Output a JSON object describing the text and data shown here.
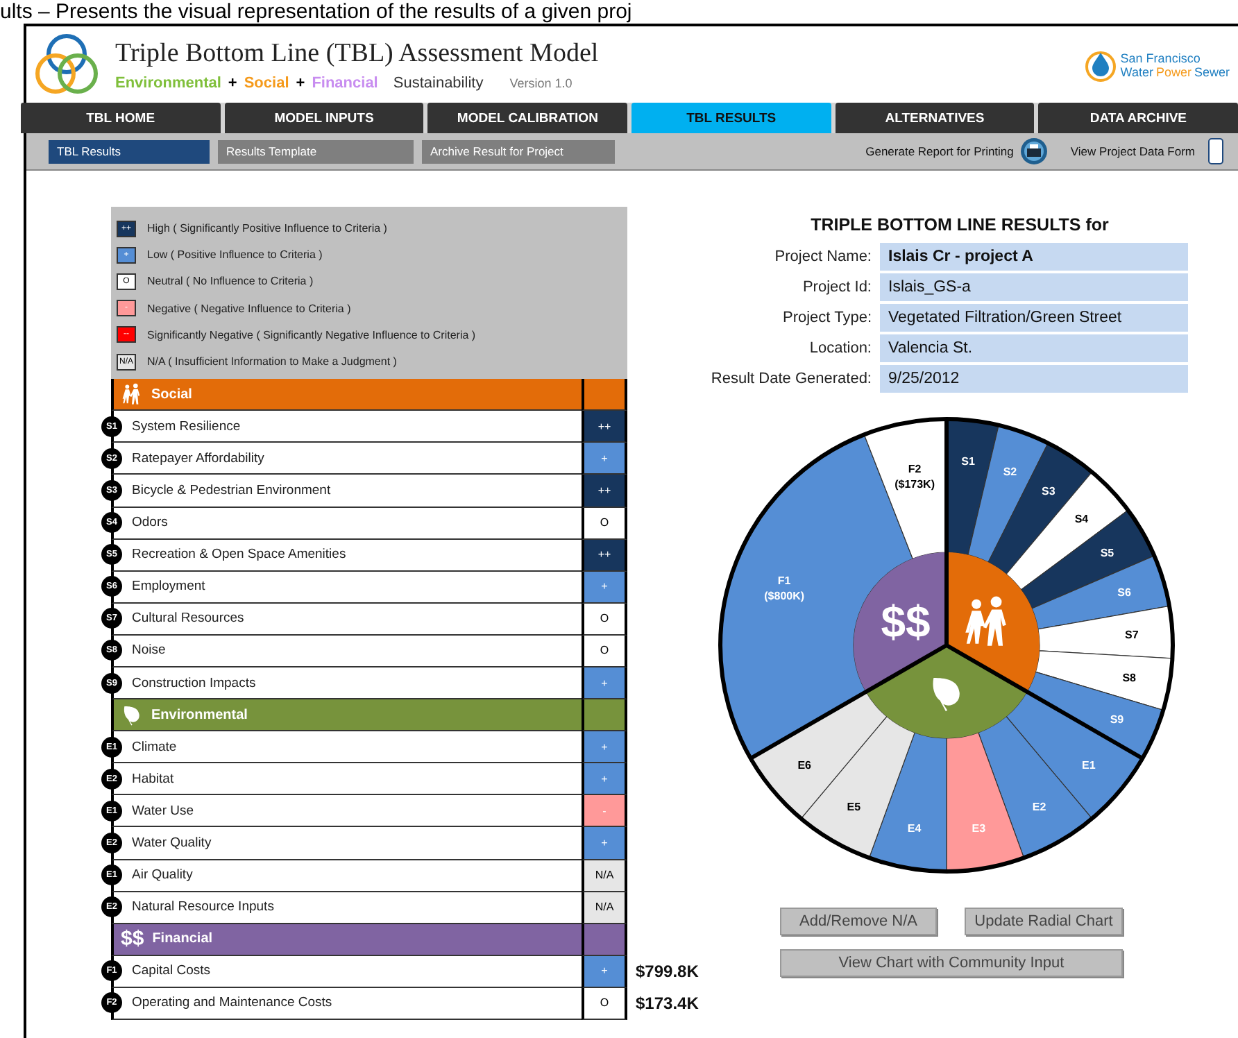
{
  "document_text": "ults – Presents the visual representation of the results of a given proj",
  "header": {
    "title": "Triple Bottom Line (TBL) Assessment Model",
    "tagline": [
      {
        "text": "Environmental",
        "color": "#7fbf3a"
      },
      {
        "text": "+",
        "color": "#000000"
      },
      {
        "text": "Social",
        "color": "#f59a1b"
      },
      {
        "text": "+",
        "color": "#000000"
      },
      {
        "text": "Financial",
        "color": "#c88df0"
      },
      {
        "text": "Sustainability",
        "color": "#333333"
      }
    ],
    "version": "Version 1.0",
    "agency_logo": {
      "line1": "San Francisco",
      "words": [
        {
          "text": "Water",
          "color": "#1f7fc1"
        },
        {
          "text": "Power",
          "color": "#f59a1b"
        },
        {
          "text": "Sewer",
          "color": "#1f7fc1"
        }
      ]
    }
  },
  "tabs": [
    {
      "label": "TBL HOME",
      "selected": false
    },
    {
      "label": "MODEL INPUTS",
      "selected": false
    },
    {
      "label": "MODEL CALIBRATION",
      "selected": false
    },
    {
      "label": "TBL RESULTS",
      "selected": true
    },
    {
      "label": "ALTERNATIVES",
      "selected": false
    },
    {
      "label": "DATA ARCHIVE",
      "selected": false
    }
  ],
  "subtabs": [
    {
      "label": "TBL Results",
      "selected": true
    },
    {
      "label": "Results Template",
      "selected": false
    },
    {
      "label": "Archive Result for Project",
      "selected": false
    }
  ],
  "actions": [
    {
      "label": "Generate Report for Printing",
      "kind": "print"
    },
    {
      "label": "View Project Data Form",
      "kind": "form"
    }
  ],
  "legend": [
    {
      "kind": "high",
      "symbol": "++",
      "label": "High ( Significantly Positive Influence to Criteria )"
    },
    {
      "kind": "low",
      "symbol": "+",
      "label": "Low  ( Positive Influence to Criteria )"
    },
    {
      "kind": "neutral",
      "symbol": "O",
      "label": "Neutral  ( No Influence to Criteria )"
    },
    {
      "kind": "negative",
      "symbol": "-",
      "label": "Negative  ( Negative Influence to Criteria )"
    },
    {
      "kind": "severe",
      "symbol": "--",
      "label": "Significantly Negative ( Significantly Negative Influence to Criteria )"
    },
    {
      "kind": "na",
      "symbol": "N/A",
      "label": "N/A  ( Insufficient Information to Make a Judgment )"
    }
  ],
  "sections": [
    {
      "kind": "social",
      "title": "Social",
      "rows": [
        {
          "code": "S1",
          "name": "System Resilience",
          "kind": "high",
          "symbol": "++"
        },
        {
          "code": "S2",
          "name": "Ratepayer Affordability",
          "kind": "low",
          "symbol": "+"
        },
        {
          "code": "S3",
          "name": "Bicycle & Pedestrian Environment",
          "kind": "high",
          "symbol": "++"
        },
        {
          "code": "S4",
          "name": "Odors",
          "kind": "neutral",
          "symbol": "O"
        },
        {
          "code": "S5",
          "name": "Recreation  & Open Space Amenities",
          "kind": "high",
          "symbol": "++"
        },
        {
          "code": "S6",
          "name": "Employment",
          "kind": "low",
          "symbol": "+"
        },
        {
          "code": "S7",
          "name": "Cultural Resources",
          "kind": "neutral",
          "symbol": "O"
        },
        {
          "code": "S8",
          "name": "Noise",
          "kind": "neutral",
          "symbol": "O"
        },
        {
          "code": "S9",
          "name": "Construction Impacts",
          "kind": "low",
          "symbol": "+"
        }
      ]
    },
    {
      "kind": "environmental",
      "title": "Environmental",
      "rows": [
        {
          "code": "E1",
          "name": "Climate",
          "kind": "low",
          "symbol": "+"
        },
        {
          "code": "E2",
          "name": "Habitat",
          "kind": "low",
          "symbol": "+"
        },
        {
          "code": "E1",
          "name": "Water Use",
          "kind": "negative",
          "symbol": "-"
        },
        {
          "code": "E2",
          "name": "Water Quality",
          "kind": "low",
          "symbol": "+"
        },
        {
          "code": "E1",
          "name": "Air Quality",
          "kind": "na",
          "symbol": "N/A"
        },
        {
          "code": "E2",
          "name": "Natural Resource Inputs",
          "kind": "na",
          "symbol": "N/A"
        }
      ]
    },
    {
      "kind": "financial",
      "symbol": "$$",
      "title": "Financial",
      "rows": [
        {
          "code": "F1",
          "name": "Capital Costs",
          "kind": "low",
          "symbol": "+",
          "amount": "$799.8K"
        },
        {
          "code": "F2",
          "name": "Operating and Maintenance Costs",
          "kind": "neutral",
          "symbol": "O",
          "amount": "$173.4K"
        }
      ]
    }
  ],
  "results": {
    "title": "TRIPLE BOTTOM LINE RESULTS for",
    "fields": [
      {
        "label": "Project Name:",
        "value": "Islais Cr - project  A",
        "bold": true
      },
      {
        "label": "Project Id:",
        "value": "Islais_GS-a",
        "bold": false
      },
      {
        "label": "Project Type:",
        "value": "Vegetated Filtration/Green Street",
        "bold": false
      },
      {
        "label": "Location:",
        "value": "Valencia St.",
        "bold": false
      },
      {
        "label": "Result Date Generated:",
        "value": "9/25/2012",
        "bold": false
      }
    ]
  },
  "wheel": {
    "sectors": [
      {
        "kind": "social",
        "wedges": [
          {
            "label": "S1",
            "kind": "high"
          },
          {
            "label": "S2",
            "kind": "low"
          },
          {
            "label": "S3",
            "kind": "high"
          },
          {
            "label": "S4",
            "kind": "neutral"
          },
          {
            "label": "S5",
            "kind": "high"
          },
          {
            "label": "S6",
            "kind": "low"
          },
          {
            "label": "S7",
            "kind": "neutral"
          },
          {
            "label": "S8",
            "kind": "neutral"
          },
          {
            "label": "S9",
            "kind": "low"
          }
        ]
      },
      {
        "kind": "environmental",
        "wedges": [
          {
            "label": "E1",
            "kind": "low"
          },
          {
            "label": "E2",
            "kind": "low"
          },
          {
            "label": "E3",
            "kind": "negative"
          },
          {
            "label": "E4",
            "kind": "low"
          },
          {
            "label": "E5",
            "kind": "na"
          },
          {
            "label": "E6",
            "kind": "na"
          }
        ]
      },
      {
        "kind": "financial",
        "symbol": "$$",
        "wedges": [
          {
            "label": "F1",
            "amount": "($800K)",
            "kind": "low"
          },
          {
            "label": "F2",
            "amount": "($173K)",
            "kind": "neutral"
          }
        ]
      }
    ]
  },
  "buttons": [
    "Add/Remove N/A",
    "Update Radial Chart",
    "View Chart with Community Input"
  ]
}
